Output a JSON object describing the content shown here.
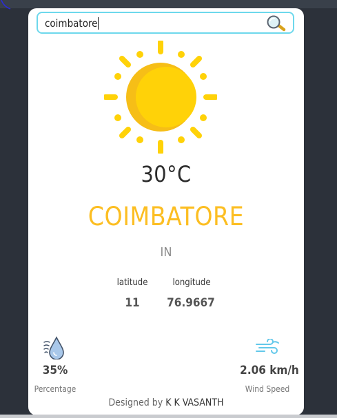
{
  "search": {
    "value": "coimbatore",
    "icon": "magnifier-icon"
  },
  "weather": {
    "icon": "sun-icon",
    "temperature": "30°C",
    "city": "COIMBATORE",
    "country": "IN"
  },
  "coords": {
    "latitude_label": "latitude",
    "latitude_value": "11",
    "longitude_label": "longitude",
    "longitude_value": "76.9667"
  },
  "stats": {
    "humidity_value": "35%",
    "humidity_label": "Percentage",
    "humidity_icon": "humidity-drop-icon",
    "wind_value": "2.06 km/h",
    "wind_label": "Wind Speed",
    "wind_icon": "wind-icon"
  },
  "footer": {
    "prefix": "Designed by",
    "name": "K K VASANTH"
  },
  "colors": {
    "accent": "#fcbe22",
    "sun": "#ffd208",
    "search_border": "#6dd8ec",
    "background": "#2c313a",
    "card": "#ffffff"
  }
}
